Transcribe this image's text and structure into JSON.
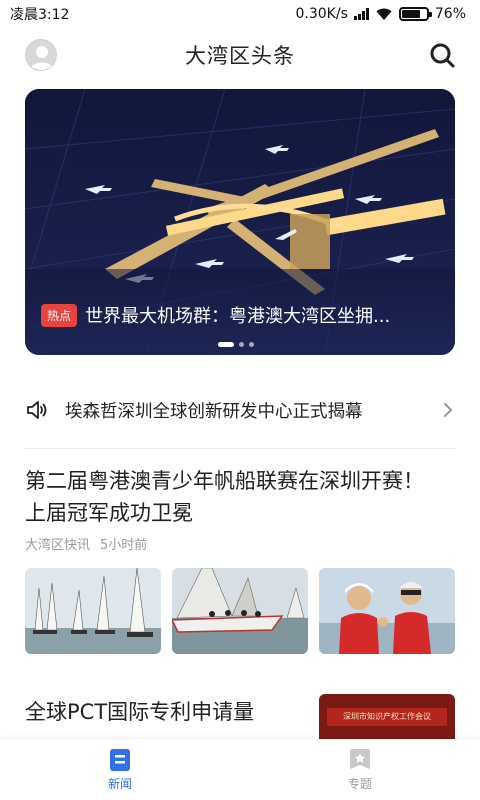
{
  "status_bar": {
    "time": "凌晨3:12",
    "speed": "0.30K/s",
    "battery": "76%",
    "battery_level": 0.76
  },
  "header": {
    "title": "大湾区头条",
    "avatar_icon": "user-avatar-icon",
    "search_icon": "search-icon"
  },
  "banner": {
    "tag": "热点",
    "title": "世界最大机场群：粤港澳大湾区坐拥...",
    "slide_count": 3,
    "active_slide": 1
  },
  "notice": {
    "icon": "speaker-icon",
    "text": "埃森哲深圳全球创新研发中心正式揭幕",
    "arrow_icon": "chevron-right-icon"
  },
  "articles": [
    {
      "title": "第二届粤港澳青少年帆船联赛在深圳开赛！上届冠军成功卫冕",
      "source": "大湾区快讯",
      "time": "5小时前"
    },
    {
      "title": "全球PCT国际专利申请量",
      "thumb_text": "深圳市知识产权工作会议"
    }
  ],
  "bottom_nav": {
    "items": [
      {
        "label": "新闻",
        "icon": "news-icon",
        "active": true
      },
      {
        "label": "专题",
        "icon": "topic-star-icon",
        "active": false
      }
    ],
    "active_color": "#2f6fe8",
    "inactive_color": "#9a9a9a"
  }
}
